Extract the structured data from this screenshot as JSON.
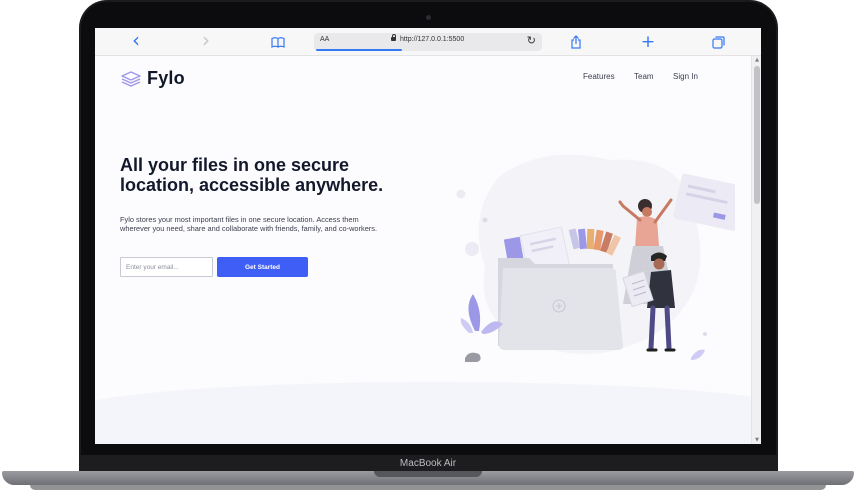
{
  "device": {
    "model_label": "MacBook Air"
  },
  "browser": {
    "icons": [
      "back-icon",
      "forward-icon",
      "bookmarks-icon",
      "reload-icon",
      "share-icon",
      "new-tab-icon",
      "tabs-icon"
    ],
    "back_glyph": "‹",
    "forward_glyph": "›",
    "new_tab_glyph": "+",
    "reload_glyph": "↻",
    "url_bar": {
      "text_size_label": "AA",
      "url": "http://127.0.0.1:5500"
    },
    "accent": "#3478f6"
  },
  "page": {
    "logo": {
      "text": "Fylo"
    },
    "nav": [
      {
        "label": "Features"
      },
      {
        "label": "Team"
      },
      {
        "label": "Sign In"
      }
    ],
    "hero": {
      "title": "All your files in one secure location, accessible anywhere.",
      "description": "Fylo stores your most important files in one secure location. Access them wherever you need, share and collaborate with friends, family, and co-workers.",
      "email_placeholder": "Enter your email...",
      "cta_label": "Get Started"
    },
    "colors": {
      "accent": "#3f5ef6",
      "title": "#14182b",
      "illustration_purple": "#9d97e8",
      "illustration_shirt": "#e8a495"
    }
  }
}
